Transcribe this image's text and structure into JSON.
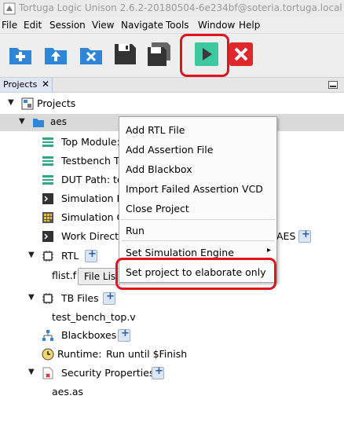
{
  "window": {
    "title": "Tortuga Logic Unison 2.6.2-20180504-6e234bf@soteria.tortuga.local"
  },
  "menu": [
    "File",
    "Edit",
    "Session",
    "View",
    "Navigate",
    "Tools",
    "Window",
    "Help"
  ],
  "toolbar": {
    "buttons": [
      "new-project",
      "import-project",
      "close-project",
      "save",
      "save-all",
      "run",
      "stop"
    ]
  },
  "panel": {
    "tab_label": "Projects",
    "tab_close": "✕"
  },
  "tree": {
    "root": "Projects",
    "project": "aes",
    "top_module": "Top Module:",
    "testbench": "Testbench To",
    "dut_path": "DUT Path: te",
    "simulation_r": "Simulation R",
    "simulation_c": "Simulation Co",
    "work_dir": "Work Directo",
    "work_dir_tail": "AES",
    "rtl": "RTL",
    "flist": "flist.f",
    "file_list_button": "File Lis",
    "tb_files": "TB Files",
    "tb_file": "test_bench_top.v",
    "blackboxes": "Blackboxes",
    "runtime_label": "Runtime:",
    "runtime_value": "Run until $Finish",
    "security_properties": "Security Properties",
    "security_file": "aes.as"
  },
  "context_menu": {
    "items": [
      "Add RTL File",
      "Add Assertion File",
      "Add Blackbox",
      "Import Failed Assertion VCD",
      "Close Project",
      "Run",
      "Set Simulation Engine",
      "Set project to elaborate only"
    ],
    "submenu_arrow": "▸"
  },
  "colors": {
    "highlight": "#e0141e",
    "run_green": "#3cc8a0",
    "stop_red": "#e0282c",
    "folder_blue": "#2f86d6"
  }
}
